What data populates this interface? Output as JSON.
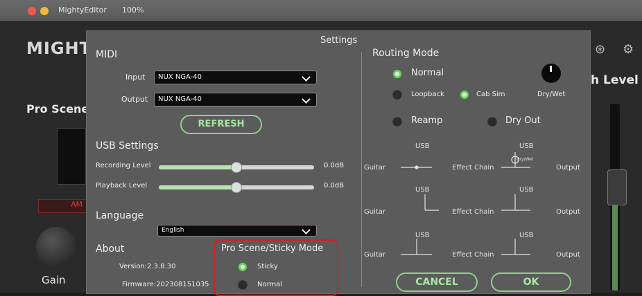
{
  "app": {
    "name": "MightyEditor",
    "zoom": "100%",
    "logo": "MIGHT",
    "bg_scene": "Pro Scene",
    "bg_right": "h Level",
    "bg_gain": "Gain",
    "bg_amp": "AM"
  },
  "dialog": {
    "title": "Settings",
    "midi": {
      "title": "MIDI",
      "input_label": "Input",
      "input_value": "NUX NGA-40",
      "output_label": "Output",
      "output_value": "NUX NGA-40",
      "refresh_label": "REFRESH"
    },
    "usb": {
      "title": "USB Settings",
      "recording_label": "Recording Level",
      "recording_value": "0.0dB",
      "recording_level": 0.5,
      "playback_label": "Playback Level",
      "playback_value": "0.0dB",
      "playback_level": 0.5
    },
    "language": {
      "title": "Language",
      "value": "English"
    },
    "about": {
      "title": "About",
      "version": "Version:2.3.8.30",
      "firmware": "Firmware:202308151035"
    },
    "pro_scene": {
      "title": "Pro Scene/Sticky Mode",
      "options": [
        "Sticky",
        "Normal"
      ],
      "selected": "Sticky"
    },
    "routing": {
      "title": "Routing Mode",
      "normal": "Normal",
      "loopback": "Loopback",
      "cab_sim": "Cab Sim",
      "dry_wet": "Dry/Wet",
      "reamp": "Reamp",
      "dry_out": "Dry Out",
      "selected": [
        "Normal",
        "Cab Sim"
      ],
      "diagram": {
        "guitar": "Guitar",
        "effect_chain": "Effect Chain",
        "output": "Output",
        "usb": "USB",
        "dry_wet_small": "Dry/Wet"
      }
    },
    "buttons": {
      "cancel": "CANCEL",
      "ok": "OK"
    }
  },
  "colors": {
    "accent": "#8fd18a",
    "highlight": "#d81f1f",
    "dialog_bg": "#5b5b5b"
  }
}
